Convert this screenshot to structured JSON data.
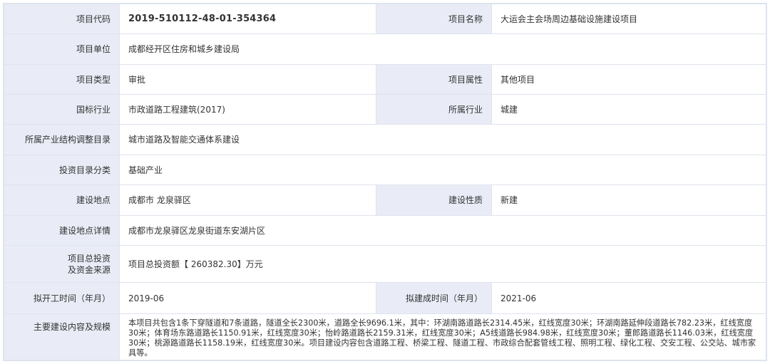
{
  "rows": {
    "code_label": "项目代码",
    "code_value": "2019-510112-48-01-354364",
    "name_label": "项目名称",
    "name_value": "大运会主会场周边基础设施建设项目",
    "unit_label": "项目单位",
    "unit_value": "成都经开区住房和城乡建设局",
    "type_label": "项目类型",
    "type_value": "审批",
    "attr_label": "项目属性",
    "attr_value": "其他项目",
    "intl_label": "国标行业",
    "intl_value": "市政道路工程建筑(2017)",
    "industry_label": "所属行业",
    "industry_value": "城建",
    "catalog_label": "所属产业结构调整目录",
    "catalog_value": "城市道路及智能交通体系建设",
    "invest_cat_label": "投资目录分类",
    "invest_cat_value": "基础产业",
    "site_label": "建设地点",
    "site_value": "成都市 龙泉驿区",
    "nature_label": "建设性质",
    "nature_value": "新建",
    "site_detail_label": "建设地点详情",
    "site_detail_value": "成都市龙泉驿区龙泉街道东安湖片区",
    "fund_label_1": "项目总投资",
    "fund_label_2": "及资金来源",
    "fund_value": "项目总投资额【 260382.30】万元",
    "start_label": "拟开工时间（年月）",
    "start_value": "2019-06",
    "finish_label": "拟建成时间（年月）",
    "finish_value": "2021-06",
    "scope_label": "主要建设内容及规模",
    "scope_value": "本项目共包含1条下穿隧道和7条道路，隧道全长2300米，道路全长9696.1米，其中：环湖南路道路长2314.45米，红线宽度30米；环湖南路延伸段道路长782.23米，红线宽度30米；体育场东路道路长1150.91米，红线宽度30米；怡岭路道路长2159.31米，红线宽度30米；A5线道路长984.98米，红线宽度30米；董郎路道路长1146.03米，红线宽度30米；桃源路道路长1158.19米，红线宽度30米。项目建设内容包含道路工程、桥梁工程、隧道工程、市政综合配套管线工程、照明工程、绿化工程、交安工程、公交站、城市家具等。"
  }
}
